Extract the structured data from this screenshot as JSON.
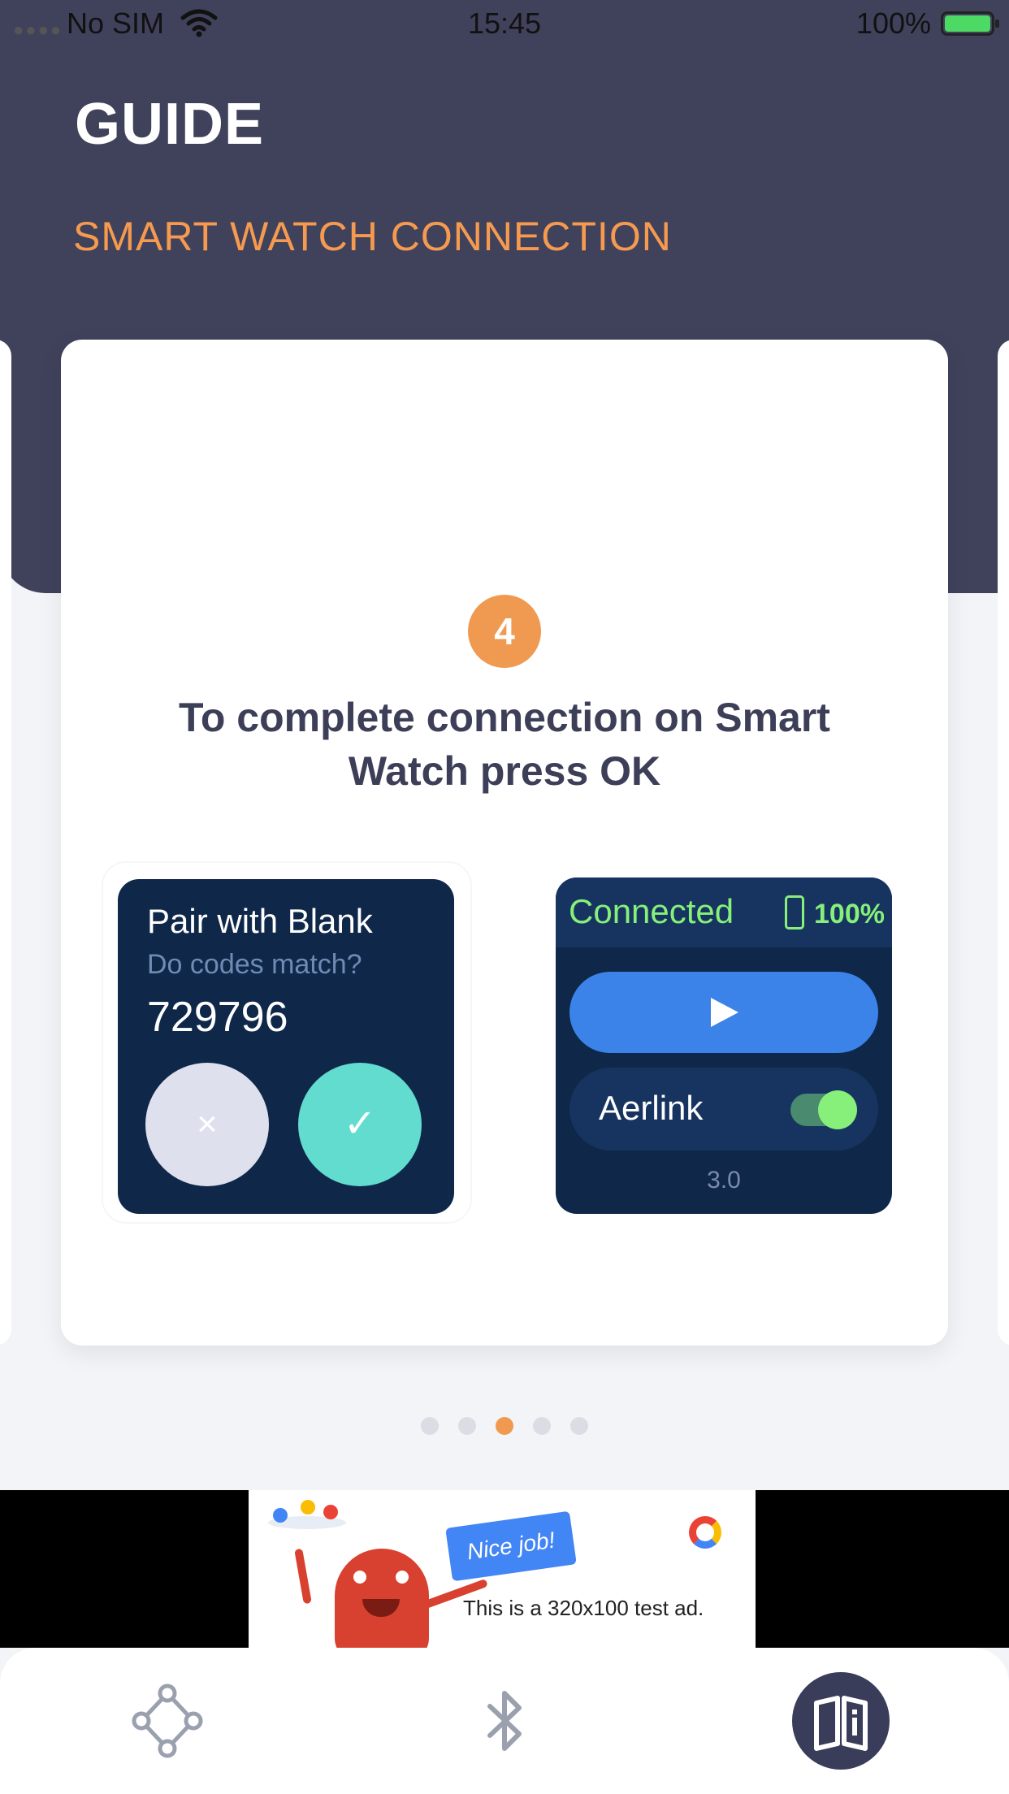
{
  "status_bar": {
    "carrier": "No SIM",
    "time": "15:45",
    "battery": "100%"
  },
  "header": {
    "title": "GUIDE",
    "subtitle": "SMART WATCH CONNECTION"
  },
  "step": {
    "number": "4",
    "text": "To complete connection on Smart Watch press OK"
  },
  "pair_watch": {
    "title": "Pair with Blank",
    "subtitle": "Do codes match?",
    "code": "729796",
    "reject_symbol": "×",
    "accept_symbol": "✓"
  },
  "connected_watch": {
    "status": "Connected",
    "battery": "100%",
    "device_name": "Aerlink",
    "toggle_on": true,
    "version": "3.0"
  },
  "pager": {
    "total": 5,
    "active_index": 2
  },
  "ad": {
    "badge": "Nice job!",
    "text": "This is a 320x100 test ad."
  },
  "tab_bar": {
    "items": [
      {
        "icon": "nodes-icon",
        "active": false
      },
      {
        "icon": "bluetooth-icon",
        "active": false
      },
      {
        "icon": "guide-book-icon",
        "active": true
      }
    ]
  },
  "colors": {
    "header_bg": "#40425c",
    "accent_orange": "#ef9a50",
    "watch_bg": "#0f2749",
    "connected_green": "#86f07a",
    "play_blue": "#3b83e8",
    "accept_teal": "#62dccf"
  }
}
